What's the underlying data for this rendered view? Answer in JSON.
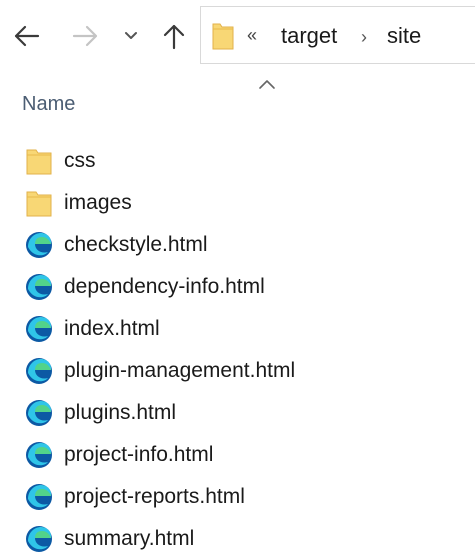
{
  "nav": {
    "back_icon": "arrow-left-icon",
    "forward_icon": "arrow-right-icon",
    "recent_icon": "chevron-down-icon",
    "up_icon": "arrow-up-icon"
  },
  "address": {
    "overflow": "«",
    "segments": [
      "target",
      "site"
    ],
    "separator": "›"
  },
  "columns": {
    "name": "Name",
    "sort": "ascending"
  },
  "colors": {
    "folder": "#f8d775",
    "folder_dark": "#e8b94a",
    "edge_blue": "#0c59a4",
    "edge_teal": "#2fc5e8",
    "edge_green": "#52d38a"
  },
  "files": [
    {
      "name": "css",
      "type": "folder",
      "icon": "folder-icon"
    },
    {
      "name": "images",
      "type": "folder",
      "icon": "folder-icon"
    },
    {
      "name": "checkstyle.html",
      "type": "html",
      "icon": "edge-icon"
    },
    {
      "name": "dependency-info.html",
      "type": "html",
      "icon": "edge-icon"
    },
    {
      "name": "index.html",
      "type": "html",
      "icon": "edge-icon"
    },
    {
      "name": "plugin-management.html",
      "type": "html",
      "icon": "edge-icon"
    },
    {
      "name": "plugins.html",
      "type": "html",
      "icon": "edge-icon"
    },
    {
      "name": "project-info.html",
      "type": "html",
      "icon": "edge-icon"
    },
    {
      "name": "project-reports.html",
      "type": "html",
      "icon": "edge-icon"
    },
    {
      "name": "summary.html",
      "type": "html",
      "icon": "edge-icon"
    }
  ]
}
